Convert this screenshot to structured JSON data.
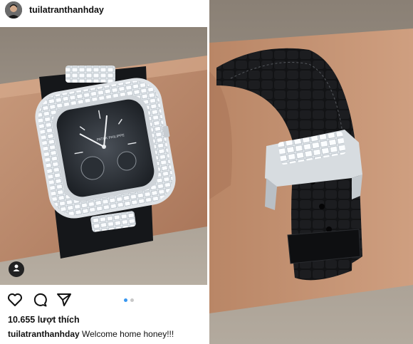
{
  "post": {
    "username": "tuilatranthanhday",
    "likes_text": "10.655 lượt thích",
    "caption_user": "tuilatranthanhday",
    "caption_text": " Welcome home honey!!!",
    "carousel": {
      "count": 2,
      "active_index": 0
    }
  },
  "colors": {
    "accent_dot": "#3897f0",
    "inactive_dot": "#c8c8c8"
  },
  "icons": [
    "heart-icon",
    "comment-icon",
    "share-icon",
    "user-tag-icon"
  ]
}
